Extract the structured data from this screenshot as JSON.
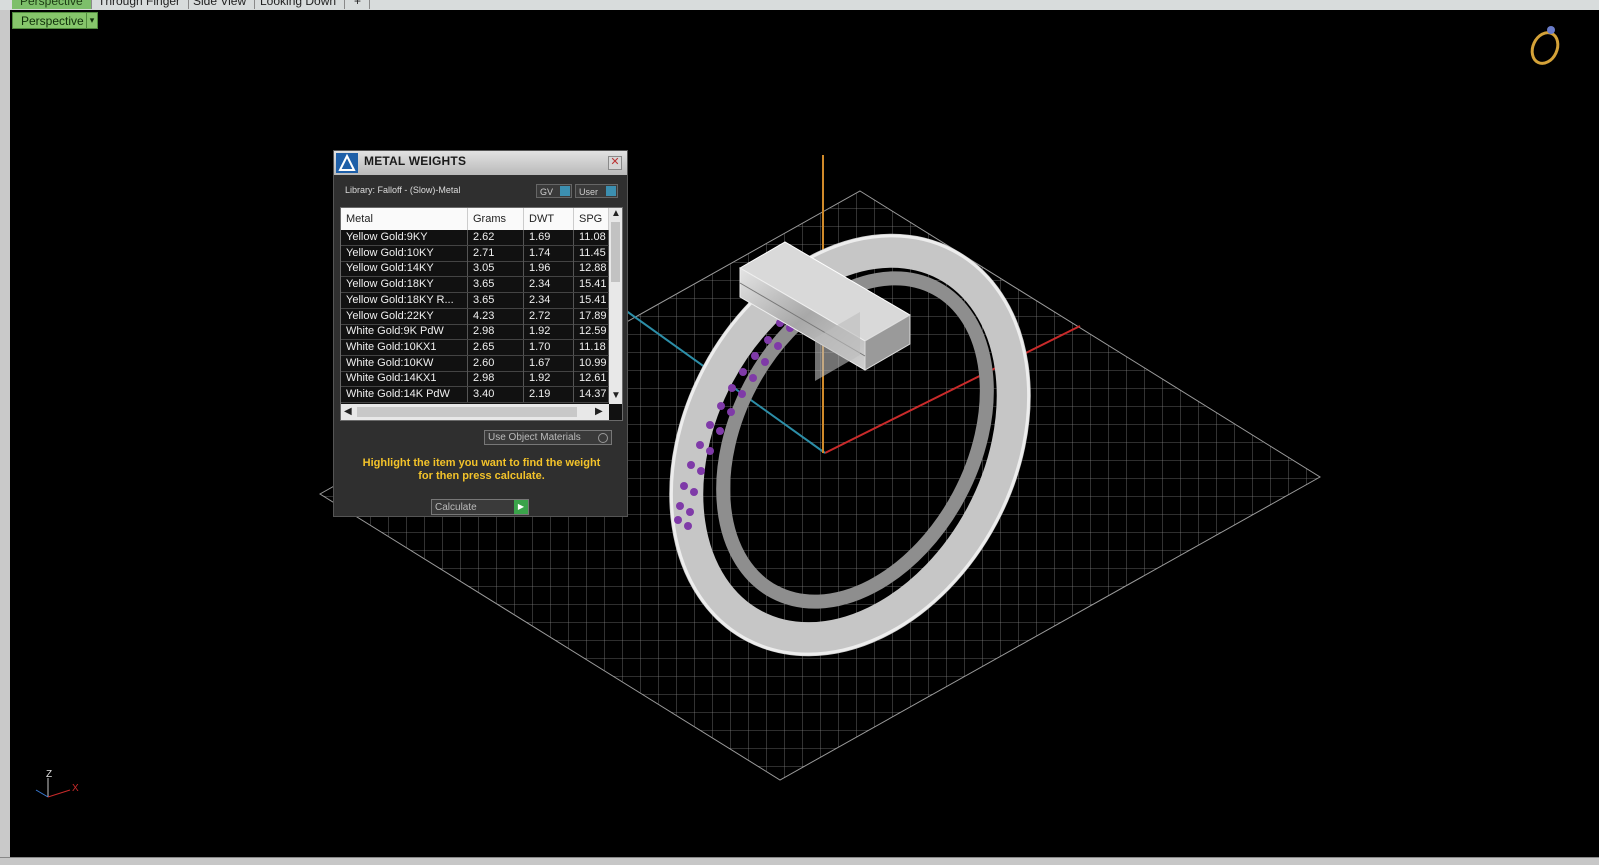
{
  "tabs": [
    "Perspective",
    "Through Finger",
    "Side View",
    "Looking Down",
    "+"
  ],
  "viewport": {
    "mode_label": "Perspective",
    "dropdown_glyph": "▾"
  },
  "panel": {
    "title": "METAL WEIGHTS",
    "library": "Library: Falloff - (Slow)-Metal",
    "toggle_gv": "GV",
    "toggle_user": "User",
    "columns": [
      "Metal",
      "Grams",
      "DWT",
      "SPG"
    ],
    "rows": [
      [
        "Yellow Gold:9KY",
        "2.62",
        "1.69",
        "11.08"
      ],
      [
        "Yellow Gold:10KY",
        "2.71",
        "1.74",
        "11.45"
      ],
      [
        "Yellow Gold:14KY",
        "3.05",
        "1.96",
        "12.88"
      ],
      [
        "Yellow Gold:18KY",
        "3.65",
        "2.34",
        "15.41"
      ],
      [
        "Yellow Gold:18KY R...",
        "3.65",
        "2.34",
        "15.41"
      ],
      [
        "Yellow Gold:22KY",
        "4.23",
        "2.72",
        "17.89"
      ],
      [
        "White Gold:9K PdW",
        "2.98",
        "1.92",
        "12.59"
      ],
      [
        "White Gold:10KX1",
        "2.65",
        "1.70",
        "11.18"
      ],
      [
        "White Gold:10KW",
        "2.60",
        "1.67",
        "10.99"
      ],
      [
        "White Gold:14KX1",
        "2.98",
        "1.92",
        "12.61"
      ],
      [
        "White Gold:14K PdW",
        "3.40",
        "2.19",
        "14.37"
      ]
    ],
    "use_object_materials": "Use Object Materials",
    "hint_line1": "Highlight the item you want to find the weight",
    "hint_line2": "for then press calculate.",
    "calculate_label": "Calculate"
  },
  "axes_gizmo": {
    "z": "Z",
    "x": "X"
  }
}
